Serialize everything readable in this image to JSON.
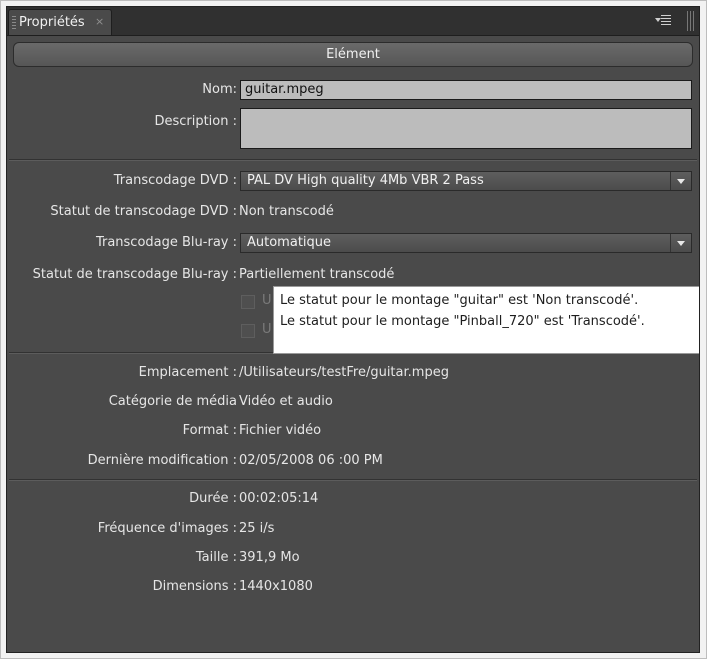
{
  "tab": {
    "title": "Propriétés",
    "close": "×"
  },
  "section": {
    "title": "Elément"
  },
  "fields": {
    "name_label": "Nom:",
    "name_value": "guitar.mpeg",
    "description_label": "Description :"
  },
  "transcode": {
    "dvd_label": "Transcodage DVD :",
    "dvd_value": "PAL DV High quality 4Mb VBR 2 Pass",
    "dvd_status_label": "Statut de transcodage DVD :",
    "dvd_status_value": "Non transcodé",
    "bluray_label": "Transcodage Blu-ray :",
    "bluray_value": "Automatique",
    "bluray_status_label": "Statut de transcodage Blu-ray :",
    "bluray_status_value": "Partiellement transcodé",
    "checkbox1_text": "U",
    "checkbox2_text": "U"
  },
  "tooltip": {
    "line1": "Le statut pour le montage \"guitar\" est 'Non transcodé'.",
    "line2": "Le statut pour le montage \"Pinball_720\" est 'Transcodé'."
  },
  "file": {
    "location_label": "Emplacement :",
    "location_value": "/Utilisateurs/testFre/guitar.mpeg",
    "media_label": "Catégorie de média",
    "media_value": "Vidéo et audio",
    "format_label": "Format :",
    "format_value": "Fichier vidéo",
    "modified_label": "Dernière modification :",
    "modified_value": "02/05/2008 06 :00 PM"
  },
  "media": {
    "duration_label": "Durée :",
    "duration_value": "00:02:05:14",
    "framerate_label": "Fréquence d'images :",
    "framerate_value": "25 i/s",
    "size_label": "Taille :",
    "size_value": "391,9 Mo",
    "dimensions_label": "Dimensions :",
    "dimensions_value": "1440x1080"
  },
  "colors": {
    "panel": "#4a4a4a",
    "tabbar": "#303030",
    "field": "#bcbcbc",
    "tooltip": "#ffffff"
  }
}
